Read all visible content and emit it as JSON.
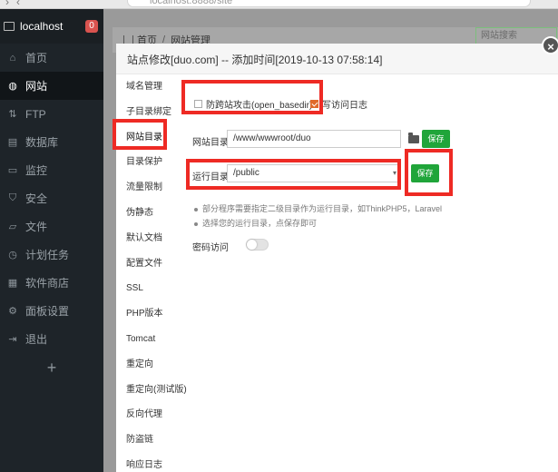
{
  "browser": {
    "url": "localhost:8888/site"
  },
  "sidebar": {
    "host": "localhost",
    "count": "0",
    "items": [
      {
        "label": "首页",
        "icon": "home-icon"
      },
      {
        "label": "网站",
        "icon": "globe-icon"
      },
      {
        "label": "FTP",
        "icon": "ftp-icon"
      },
      {
        "label": "数据库",
        "icon": "database-icon"
      },
      {
        "label": "监控",
        "icon": "monitor-icon"
      },
      {
        "label": "安全",
        "icon": "shield-icon"
      },
      {
        "label": "文件",
        "icon": "folder-icon"
      },
      {
        "label": "计划任务",
        "icon": "clock-icon"
      },
      {
        "label": "软件商店",
        "icon": "grid-icon"
      },
      {
        "label": "面板设置",
        "icon": "gear-icon"
      },
      {
        "label": "退出",
        "icon": "logout-icon"
      }
    ],
    "plus": "+"
  },
  "breadcrumb": {
    "home": "首页",
    "current": "网站管理"
  },
  "bg_search": {
    "placeholder": "网站搜索"
  },
  "modal": {
    "title": "站点修改[duo.com] -- 添加时间[2019-10-13 07:58:14]",
    "close": "×",
    "nav": [
      "域名管理",
      "子目录绑定",
      "网站目录",
      "目录保护",
      "流量限制",
      "伪静态",
      "默认文档",
      "配置文件",
      "SSL",
      "PHP版本",
      "Tomcat",
      "重定向",
      "重定向(测试版)",
      "反向代理",
      "防盗链",
      "响应日志"
    ],
    "open_basedir_label": "防跨站攻击(open_basedir)",
    "open_basedir_checked": false,
    "write_log_label": "写访问日志",
    "write_log_checked": true,
    "site_dir_label": "网站目录",
    "site_dir_value": "/www/wwwroot/duo",
    "save_label": "保存",
    "run_dir_label": "运行目录",
    "run_dir_value": "/public",
    "save2_label": "保存",
    "hints": [
      "部分程序需要指定二级目录作为运行目录，如ThinkPHP5，Laravel",
      "选择您的运行目录，点保存即可"
    ],
    "password_label": "密码访问",
    "password_enabled": false
  },
  "colors": {
    "accent_green": "#20a53a",
    "highlight_red": "#ee2a24",
    "sidebar_bg": "#1e2429"
  }
}
